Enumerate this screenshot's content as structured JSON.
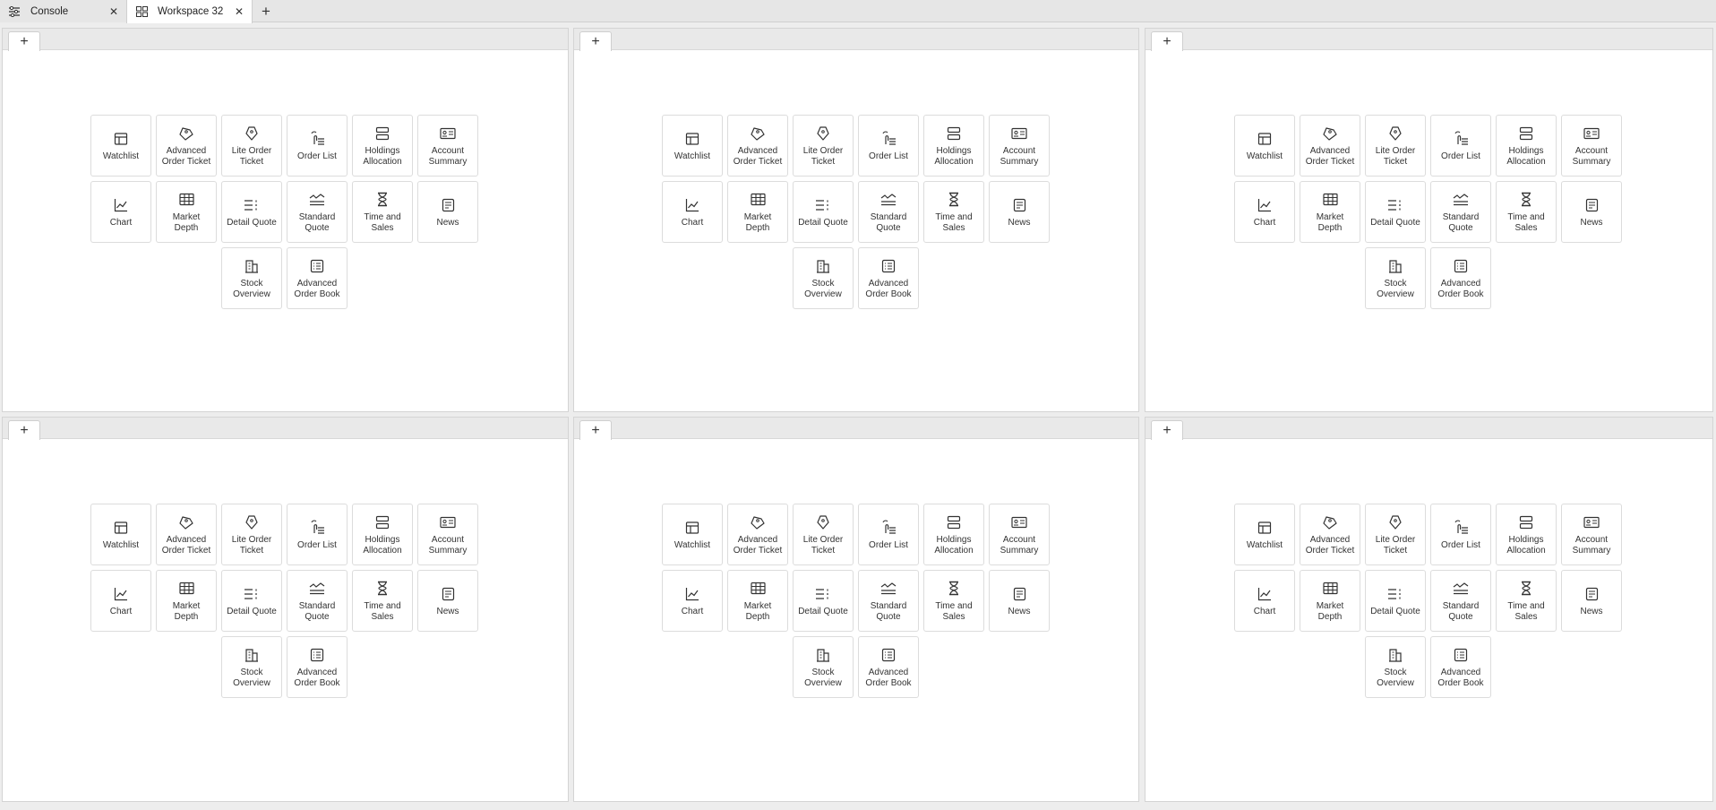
{
  "tabs": [
    {
      "label": "Console",
      "icon": "console-icon"
    },
    {
      "label": "Workspace 32",
      "icon": "workspace-grid-icon"
    }
  ],
  "new_tab_symbol": "+",
  "panel_add_symbol": "+",
  "panels": [
    {
      "id": 1
    },
    {
      "id": 2
    },
    {
      "id": 3
    },
    {
      "id": 4
    },
    {
      "id": 5
    },
    {
      "id": 6
    }
  ],
  "widgets": [
    {
      "label": "Watchlist",
      "icon": "watchlist-icon"
    },
    {
      "label": "Advanced\nOrder Ticket",
      "icon": "order-ticket-icon"
    },
    {
      "label": "Lite Order\nTicket",
      "icon": "lite-ticket-icon"
    },
    {
      "label": "Order List",
      "icon": "order-list-icon"
    },
    {
      "label": "Holdings\nAllocation",
      "icon": "holdings-icon"
    },
    {
      "label": "Account\nSummary",
      "icon": "account-card-icon"
    },
    {
      "label": "Chart",
      "icon": "line-chart-icon"
    },
    {
      "label": "Market\nDepth",
      "icon": "market-depth-icon"
    },
    {
      "label": "Detail Quote",
      "icon": "detail-quote-icon"
    },
    {
      "label": "Standard\nQuote",
      "icon": "standard-quote-icon"
    },
    {
      "label": "Time and\nSales",
      "icon": "hourglass-icon"
    },
    {
      "label": "News",
      "icon": "news-icon"
    },
    {
      "label": "Stock\nOverview",
      "icon": "building-icon"
    },
    {
      "label": "Advanced\nOrder Book",
      "icon": "order-book-icon"
    }
  ]
}
